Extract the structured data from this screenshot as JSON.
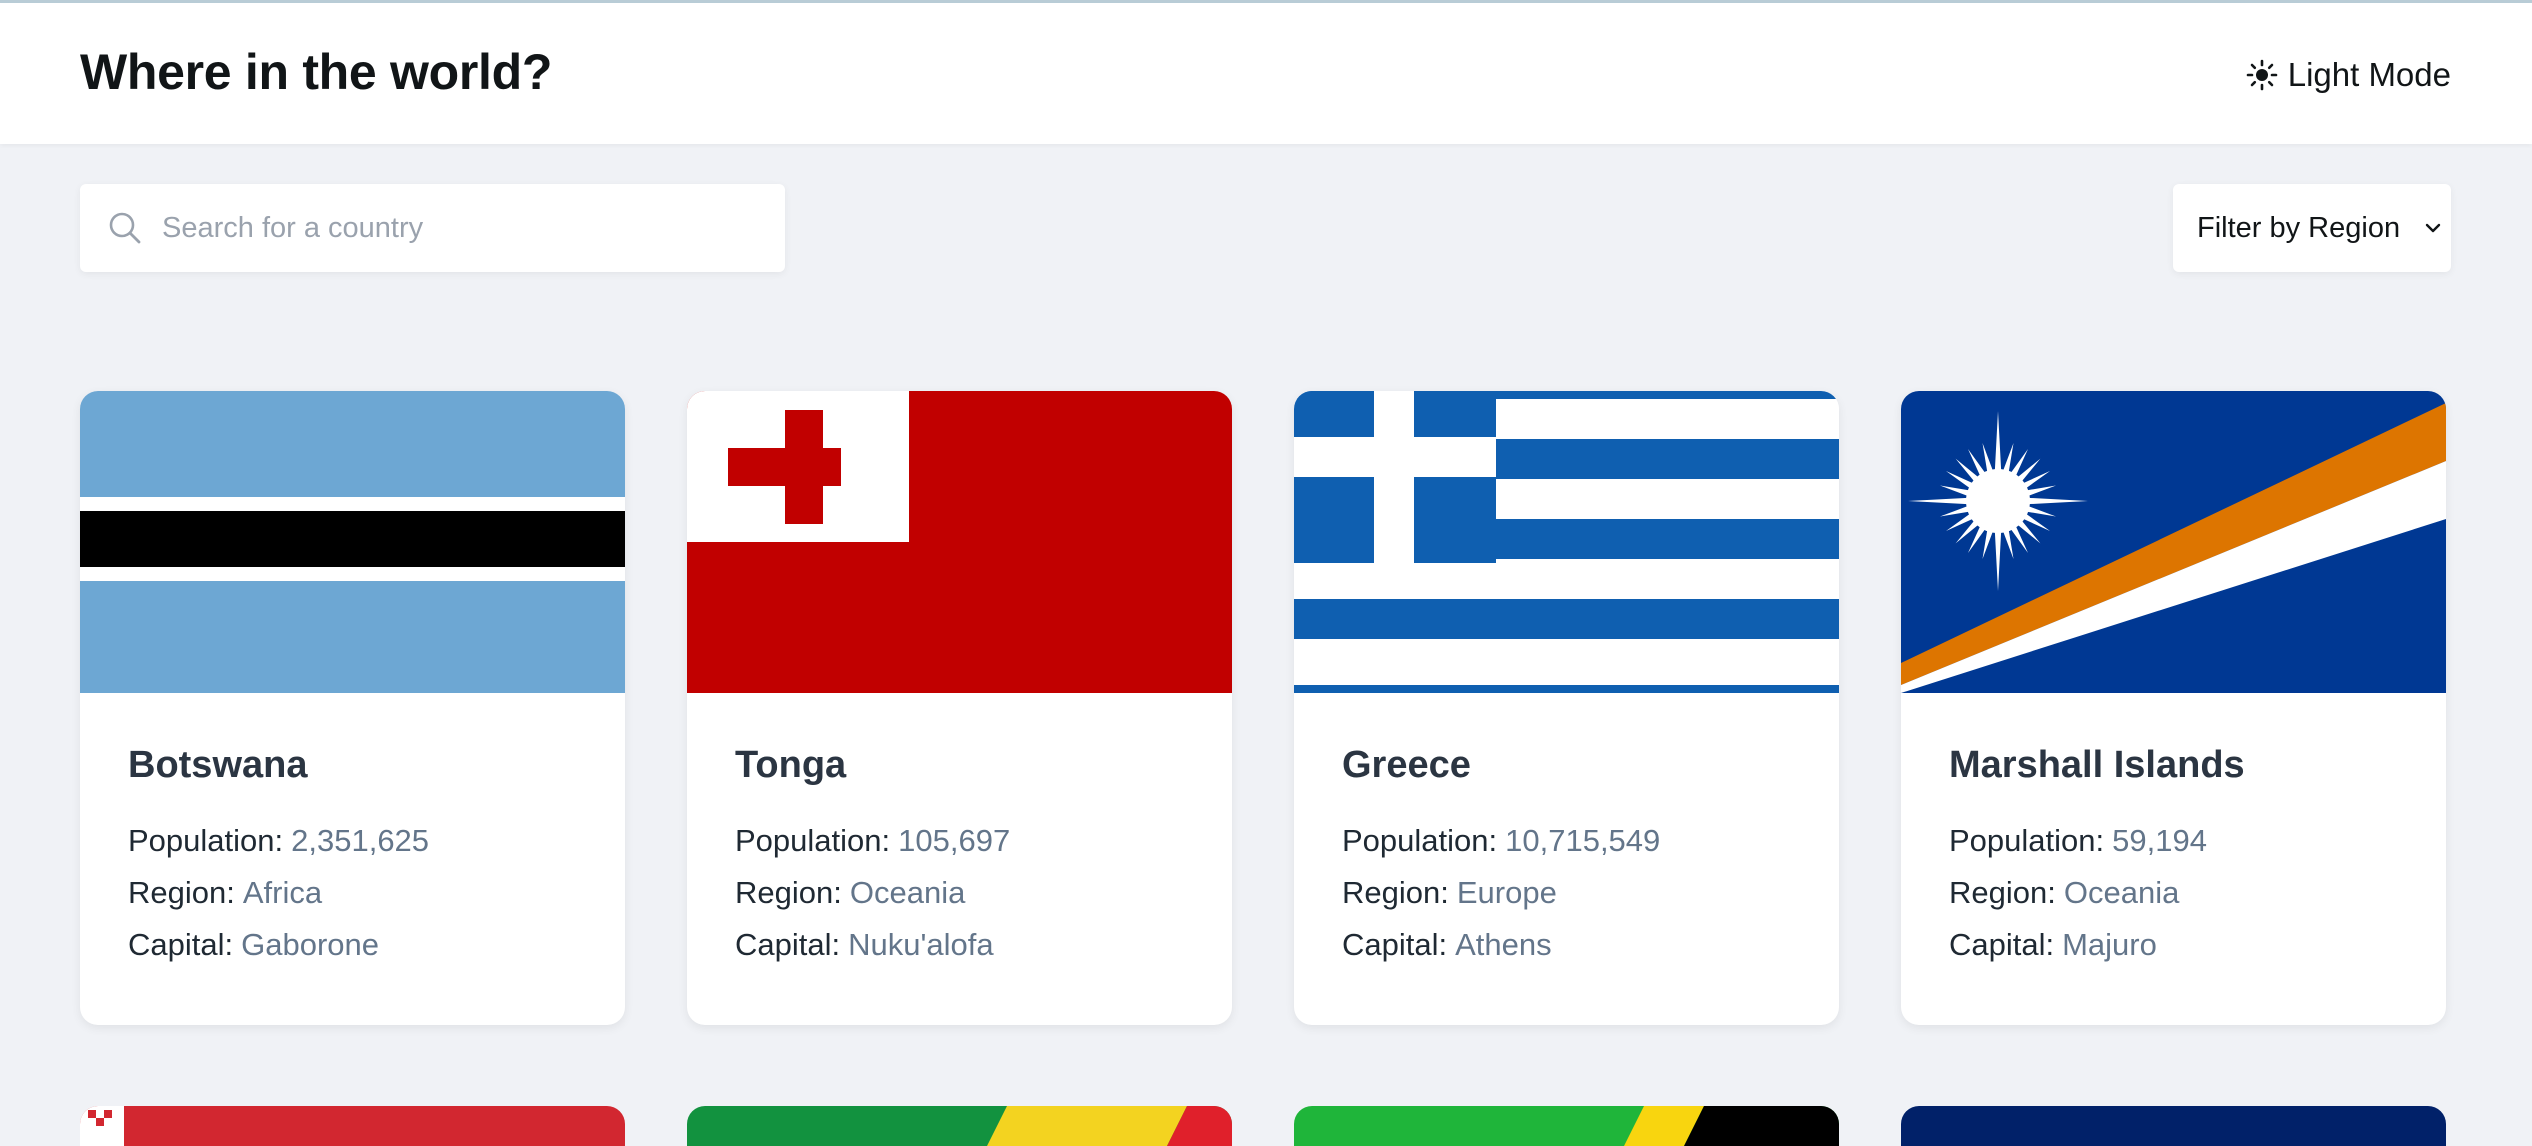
{
  "header": {
    "title": "Where in the world?",
    "theme_label": "Light Mode",
    "theme_icon": "sun-icon"
  },
  "search": {
    "placeholder": "Search for a country",
    "value": "",
    "icon": "search-icon"
  },
  "filter": {
    "label": "Filter by Region",
    "icon": "chevron-down-icon"
  },
  "labels": {
    "population": "Population:",
    "region": "Region:",
    "capital": "Capital:"
  },
  "countries": [
    {
      "name": "Botswana",
      "population": "2,351,625",
      "region": "Africa",
      "capital": "Gaborone",
      "flag": "botswana-flag"
    },
    {
      "name": "Tonga",
      "population": "105,697",
      "region": "Oceania",
      "capital": "Nuku'alofa",
      "flag": "tonga-flag"
    },
    {
      "name": "Greece",
      "population": "10,715,549",
      "region": "Europe",
      "capital": "Athens",
      "flag": "greece-flag"
    },
    {
      "name": "Marshall Islands",
      "population": "59,194",
      "region": "Oceania",
      "capital": "Majuro",
      "flag": "marshall-islands-flag"
    }
  ],
  "colors": {
    "background": "#f0f2f6",
    "text": "#111517",
    "value_text": "#63758a"
  }
}
